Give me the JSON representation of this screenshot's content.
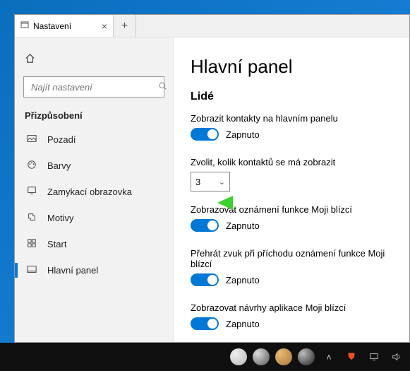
{
  "window": {
    "tab_title": "Nastavení"
  },
  "sidebar": {
    "search_placeholder": "Najít nastavení",
    "category": "Přizpůsobení",
    "items": [
      {
        "label": "Pozadí"
      },
      {
        "label": "Barvy"
      },
      {
        "label": "Zamykací obrazovka"
      },
      {
        "label": "Motivy"
      },
      {
        "label": "Start"
      },
      {
        "label": "Hlavní panel"
      }
    ]
  },
  "content": {
    "title": "Hlavní panel",
    "section": "Lidé",
    "settings": {
      "show_contacts_label": "Zobrazit kontakty na hlavním panelu",
      "show_contacts_state": "Zapnuto",
      "choose_count_label": "Zvolit, kolik kontaktů se má zobrazit",
      "choose_count_value": "3",
      "show_notif_label": "Zobrazovat oznámení funkce Moji blízcí",
      "show_notif_state": "Zapnuto",
      "play_sound_label": "Přehrát zvuk při příchodu oznámení funkce Moji blízcí",
      "play_sound_state": "Zapnuto",
      "show_sugg_label": "Zobrazovat návrhy aplikace Moji blízcí",
      "show_sugg_state": "Zapnuto"
    }
  }
}
